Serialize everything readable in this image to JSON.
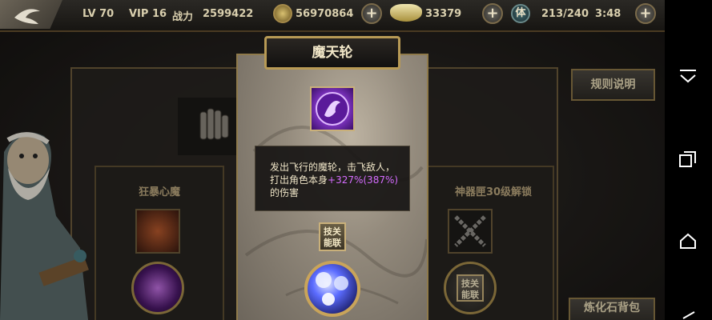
{
  "header": {
    "level": "LV 70",
    "vip": "VIP 16",
    "power_label": "战力",
    "power_value": "2599422",
    "coins": "56970864",
    "ingots": "33379",
    "stamina_label": "体",
    "stamina": "213/240",
    "timer": "3:48"
  },
  "popup": {
    "title": "魔天轮",
    "description_main": "发出飞行的魔轮，击飞敌人，打出角色本身",
    "description_bonus": "+327%(387%)",
    "description_end": "的伤害",
    "combo_tag": "技关能联"
  },
  "left_panel": {
    "title": "狂暴心魔"
  },
  "right_panel": {
    "title": "神器匣30级解锁",
    "orb_tag": "技关能联"
  },
  "buttons": {
    "rules": "规则说明",
    "bag": "炼化石背包"
  },
  "colors": {
    "gold_border": "#c9b07a",
    "bonus_text": "#d56cff",
    "panel_bg": "#26231f"
  },
  "icons": [
    "back-icon",
    "coin-icon",
    "ingot-icon",
    "stamina-icon",
    "plus-icon",
    "nav-down-icon",
    "nav-recent-icon",
    "nav-home-icon",
    "nav-back-icon"
  ]
}
